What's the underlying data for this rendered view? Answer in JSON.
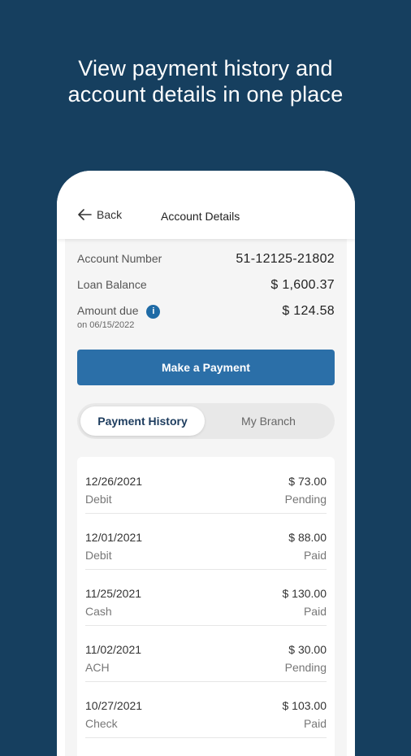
{
  "headline": {
    "line1": "View payment history and",
    "line2": "account details in one place"
  },
  "header": {
    "back_label": "Back",
    "title": "Account Details"
  },
  "account": {
    "number_label": "Account Number",
    "number": "51-12125-21802",
    "balance_label": "Loan Balance",
    "balance": "$ 1,600.37",
    "due_label": "Amount due",
    "due_info_icon": "i",
    "due_date": "on 06/15/2022",
    "due_amount": "$ 124.58"
  },
  "make_payment_label": "Make a Payment",
  "tabs": [
    {
      "label": "Payment History",
      "active": true
    },
    {
      "label": "My Branch",
      "active": false
    }
  ],
  "transactions": [
    {
      "date": "12/26/2021",
      "method": "Debit",
      "amount": "$ 73.00",
      "status": "Pending"
    },
    {
      "date": "12/01/2021",
      "method": "Debit",
      "amount": "$ 88.00",
      "status": "Paid"
    },
    {
      "date": "11/25/2021",
      "method": "Cash",
      "amount": "$ 130.00",
      "status": "Paid"
    },
    {
      "date": "11/02/2021",
      "method": "ACH",
      "amount": "$ 30.00",
      "status": "Pending"
    },
    {
      "date": "10/27/2021",
      "method": "Check",
      "amount": "$ 103.00",
      "status": "Paid"
    }
  ],
  "colors": {
    "background": "#163f5f",
    "primary_button": "#2b6fa8",
    "info_icon": "#1f6ba6"
  }
}
